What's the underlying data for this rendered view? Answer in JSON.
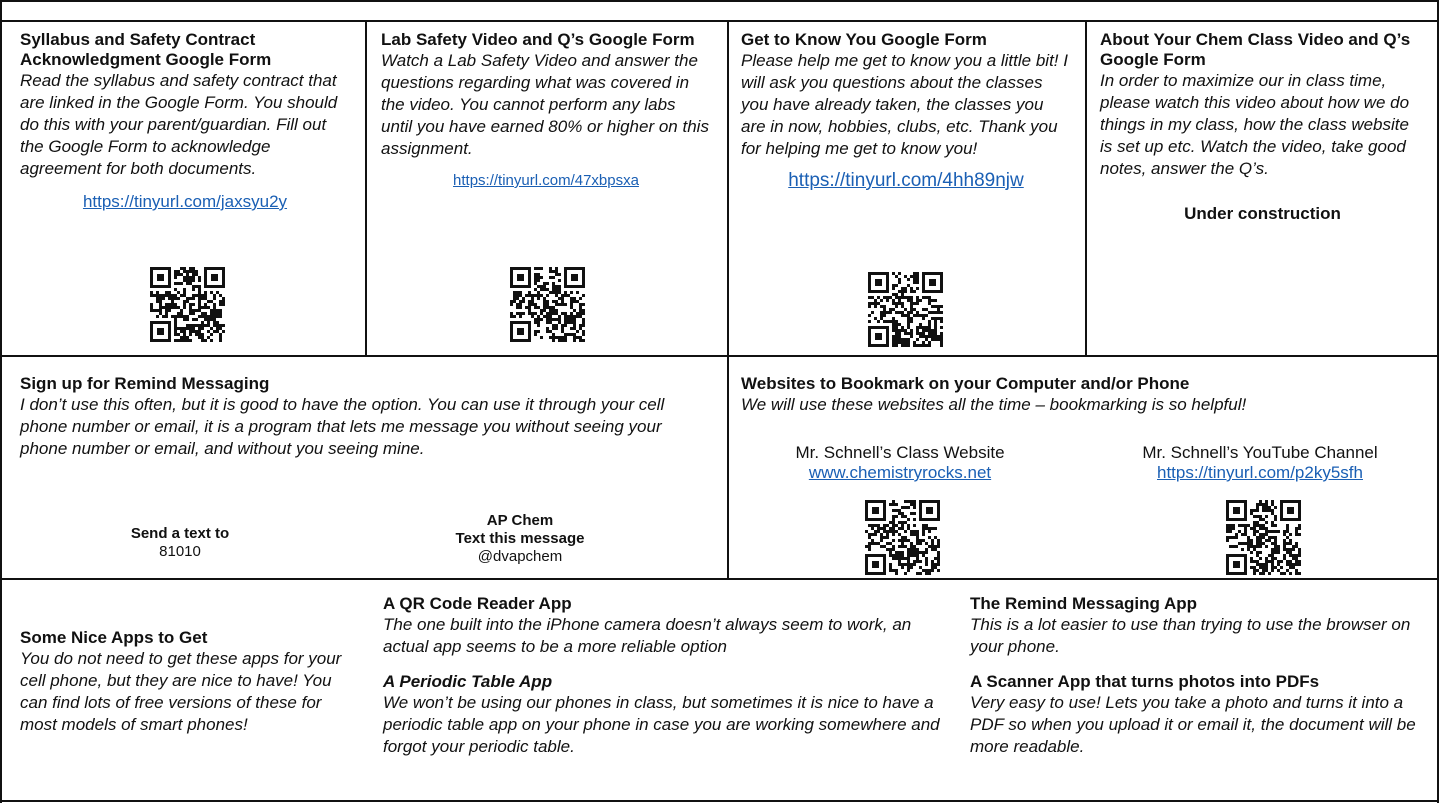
{
  "row1": [
    {
      "title": "Syllabus and Safety Contract Acknowledgment Google Form",
      "desc": "Read the syllabus and safety contract that are linked in the Google Form. You should do this with your parent/guardian. Fill out the Google Form to acknowledge agreement for both documents.",
      "link": "https://tinyurl.com/jaxsyu2y"
    },
    {
      "title": "Lab Safety Video and Q’s Google Form",
      "desc": "Watch a Lab Safety Video and answer the questions regarding what was covered in the video. You cannot perform any labs until you have earned 80% or higher on this assignment.",
      "link": "https://tinyurl.com/47xbpsxa"
    },
    {
      "title": "Get to Know You Google Form",
      "desc": "Please help me get to know you a little bit! I will ask you questions about the classes you have already taken, the classes you are in now, hobbies, clubs, etc. Thank you for helping me get to know you!",
      "link": "https://tinyurl.com/4hh89njw"
    },
    {
      "title": "About Your Chem Class Video and Q’s Google Form",
      "desc": "In order to maximize our in class time, please watch this video about how we do things in my class, how the class website is set up etc. Watch the video, take good notes, answer the Q’s.",
      "status": "Under construction"
    }
  ],
  "remind": {
    "title": "Sign up for Remind Messaging",
    "desc": "I don’t use this often, but it is good to have the option. You can use it through your cell phone number or email, it is a program that lets me message you without seeing your phone number or email, and without you seeing mine.",
    "send_label": "Send a text to",
    "send_number": "81010",
    "class_name": "AP Chem",
    "message_label": "Text this message",
    "message_code": "@dvapchem"
  },
  "websites": {
    "title": "Websites to Bookmark on your Computer and/or Phone",
    "desc": "We will use these websites all the time – bookmarking is so helpful!",
    "site1_name": "Mr. Schnell’s Class Website",
    "site1_link": "www.chemistryrocks.net",
    "site2_name": "Mr. Schnell’s YouTube Channel",
    "site2_link": "https://tinyurl.com/p2ky5sfh"
  },
  "apps": {
    "title": "Some Nice Apps to Get",
    "desc": "You do not need to get these apps for your cell phone, but they are nice to have! You can find lots of free versions of these for most models of smart phones!",
    "qr_title": "A QR Code Reader App",
    "qr_desc": "The one built into the iPhone camera doesn’t always seem to work, an actual app seems to be a more reliable option",
    "pt_title": "A Periodic Table App",
    "pt_desc": "We won’t be using our phones in class, but sometimes it is nice to have a periodic table app on your phone in case you are working somewhere and forgot your periodic table.",
    "remind_title": "The Remind Messaging App",
    "remind_desc": "This is a lot easier to use than trying to use the browser on your phone.",
    "scanner_title": "A Scanner App that turns photos into PDFs",
    "scanner_desc": "Very easy to use! Lets you take a photo and turns it into a PDF so when you upload it or email it, the document will be more readable."
  },
  "icons": [
    "qr-code-icon"
  ]
}
